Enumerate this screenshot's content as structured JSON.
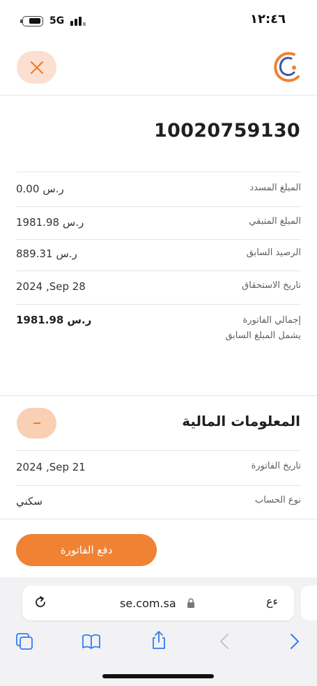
{
  "status_bar": {
    "network": "5G",
    "time": "١٢:٤٦"
  },
  "bill": {
    "number": "10020759130"
  },
  "summary": [
    {
      "label": "المبلغ المسدد",
      "amount": "0.00",
      "currency": "ر.س"
    },
    {
      "label": "المبلغ المتبقي",
      "amount": "1981.98",
      "currency": "ر.س"
    },
    {
      "label": "الرصيد السابق",
      "amount": "889.31",
      "currency": "ر.س"
    },
    {
      "label": "تاريخ الاستحقاق",
      "amount": "2024 ,Sep 28"
    }
  ],
  "total": {
    "label": "إجمالي الفاتورة",
    "sublabel": "يشمل المبلغ السابق",
    "amount": "1981.98",
    "currency": "ر.س"
  },
  "financial_info": {
    "title": "المعلومات المالية",
    "rows": [
      {
        "label": "تاريخ الفاتورة",
        "value": "2024 ,Sep 21"
      },
      {
        "label": "نوع الحساب",
        "value": "سكني"
      }
    ]
  },
  "pay_button_label": "دفع الفاتورة",
  "browser": {
    "url": "se.com.sa",
    "text_size_label": "ﺀﻉ"
  },
  "colors": {
    "accent": "#f08233",
    "accent_light": "#fbe0d1",
    "link_blue": "#2f7cf6"
  }
}
